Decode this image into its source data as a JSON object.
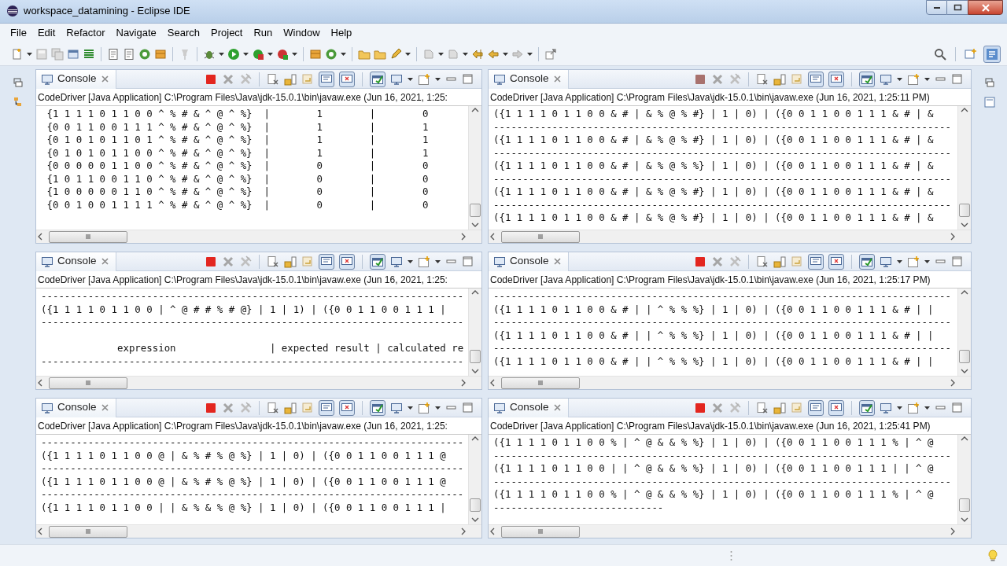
{
  "window": {
    "title": "workspace_datamining - Eclipse IDE"
  },
  "menu": [
    "File",
    "Edit",
    "Refactor",
    "Navigate",
    "Search",
    "Project",
    "Run",
    "Window",
    "Help"
  ],
  "console_toolbar": {
    "stdout_toggle_on": true,
    "stderr_toggle_on": true,
    "pin_on": true
  },
  "consoles": [
    {
      "tab": "Console",
      "running": true,
      "process": "CodeDriver [Java Application] C:\\Program Files\\Java\\jdk-15.0.1\\bin\\javaw.exe  (Jun 16, 2021, 1:25:",
      "lines": [
        {
          "kind": "text",
          "text": " {1 1 1 1 0 1 1 0 0 ^ % # & ^ @ ^ %}  |        1        |        0"
        },
        {
          "kind": "text",
          "text": " {0 0 1 1 0 0 1 1 1 ^ % # & ^ @ ^ %}  |        1        |        1"
        },
        {
          "kind": "text",
          "text": " {0 1 0 1 0 1 1 0 1 ^ % # & ^ @ ^ %}  |        1        |        1"
        },
        {
          "kind": "text",
          "text": " {0 1 0 1 0 1 1 0 0 ^ % # & ^ @ ^ %}  |        1        |        1"
        },
        {
          "kind": "text",
          "text": " {0 0 0 0 0 1 1 0 0 ^ % # & ^ @ ^ %}  |        0        |        0"
        },
        {
          "kind": "text",
          "text": " {1 0 1 1 0 0 1 1 0 ^ % # & ^ @ ^ %}  |        0        |        0"
        },
        {
          "kind": "text",
          "text": " {1 0 0 0 0 0 1 1 0 ^ % # & ^ @ ^ %}  |        0        |        0"
        },
        {
          "kind": "text",
          "text": " {0 0 1 0 0 1 1 1 1 ^ % # & ^ @ ^ %}  |        0        |        0"
        }
      ]
    },
    {
      "tab": "Console",
      "running": false,
      "process": "CodeDriver [Java Application] C:\\Program Files\\Java\\jdk-15.0.1\\bin\\javaw.exe  (Jun 16, 2021, 1:25:11 PM)",
      "lines": [
        {
          "kind": "text",
          "text": "({1 1 1 1 0 1 1 0 0 & # | & % @ % #} | 1 | 0) | ({0 0 1 1 0 0 1 1 1 & # | &"
        },
        {
          "kind": "text",
          "text": "------------------------------------------------------------------------------"
        },
        {
          "kind": "text",
          "text": "({1 1 1 1 0 1 1 0 0 & # | & % @ % #} | 1 | 0) | ({0 0 1 1 0 0 1 1 1 & # | &"
        },
        {
          "kind": "text",
          "text": "------------------------------------------------------------------------------"
        },
        {
          "kind": "text",
          "text": "({1 1 1 1 0 1 1 0 0 & # | & % @ % %} | 1 | 0) | ({0 0 1 1 0 0 1 1 1 & # | &"
        },
        {
          "kind": "text",
          "text": "------------------------------------------------------------------------------"
        },
        {
          "kind": "text",
          "text": "({1 1 1 1 0 1 1 0 0 & # | & % @ % #} | 1 | 0) | ({0 0 1 1 0 0 1 1 1 & # | &"
        },
        {
          "kind": "text",
          "text": "------------------------------------------------------------------------------"
        },
        {
          "kind": "text",
          "text": "({1 1 1 1 0 1 1 0 0 & # | & % @ % #} | 1 | 0) | ({0 0 1 1 0 0 1 1 1 & # | &"
        }
      ]
    },
    {
      "tab": "Console",
      "running": true,
      "process": "CodeDriver [Java Application] C:\\Program Files\\Java\\jdk-15.0.1\\bin\\javaw.exe  (Jun 16, 2021, 1:25:",
      "lines": [
        {
          "kind": "text",
          "text": "------------------------------------------------------------------------"
        },
        {
          "kind": "text",
          "text": "({1 1 1 1 0 1 1 0 0 | ^ @ # # % # @} | 1 | 1) | ({0 0 1 1 0 0 1 1 1 |"
        },
        {
          "kind": "text",
          "text": "------------------------------------------------------------------------"
        },
        {
          "kind": "blank"
        },
        {
          "kind": "text",
          "text": "             expression                | expected result | calculated re"
        },
        {
          "kind": "text",
          "text": "------------------------------------------------------------------------"
        }
      ]
    },
    {
      "tab": "Console",
      "running": true,
      "process": "CodeDriver [Java Application] C:\\Program Files\\Java\\jdk-15.0.1\\bin\\javaw.exe  (Jun 16, 2021, 1:25:17 PM)",
      "lines": [
        {
          "kind": "text",
          "text": "------------------------------------------------------------------------------"
        },
        {
          "kind": "text",
          "text": "({1 1 1 1 0 1 1 0 0 & # | | ^ % % %} | 1 | 0) | ({0 0 1 1 0 0 1 1 1 & # | |"
        },
        {
          "kind": "text",
          "text": "------------------------------------------------------------------------------"
        },
        {
          "kind": "text",
          "text": "({1 1 1 1 0 1 1 0 0 & # | | ^ % % %} | 1 | 0) | ({0 0 1 1 0 0 1 1 1 & # | |"
        },
        {
          "kind": "text",
          "text": "------------------------------------------------------------------------------"
        },
        {
          "kind": "text",
          "text": "({1 1 1 1 0 1 1 0 0 & # | | ^ % % %} | 1 | 0) | ({0 0 1 1 0 0 1 1 1 & # | |"
        }
      ]
    },
    {
      "tab": "Console",
      "running": true,
      "process": "CodeDriver [Java Application] C:\\Program Files\\Java\\jdk-15.0.1\\bin\\javaw.exe  (Jun 16, 2021, 1:25:",
      "lines": [
        {
          "kind": "text",
          "text": "------------------------------------------------------------------------"
        },
        {
          "kind": "text",
          "text": "({1 1 1 1 0 1 1 0 0 @ | & % # % @ %} | 1 | 0) | ({0 0 1 1 0 0 1 1 1 @"
        },
        {
          "kind": "text",
          "text": "------------------------------------------------------------------------"
        },
        {
          "kind": "text",
          "text": "({1 1 1 1 0 1 1 0 0 @ | & % # % @ %} | 1 | 0) | ({0 0 1 1 0 0 1 1 1 @"
        },
        {
          "kind": "text",
          "text": "------------------------------------------------------------------------"
        },
        {
          "kind": "text",
          "text": "({1 1 1 1 0 1 1 0 0 | | & % & % @ %} | 1 | 0) | ({0 0 1 1 0 0 1 1 1 |"
        }
      ]
    },
    {
      "tab": "Console",
      "running": true,
      "process": "CodeDriver [Java Application] C:\\Program Files\\Java\\jdk-15.0.1\\bin\\javaw.exe  (Jun 16, 2021, 1:25:41 PM)",
      "lines": [
        {
          "kind": "text",
          "text": "({1 1 1 1 0 1 1 0 0 % | ^ @ & & % %} | 1 | 0) | ({0 0 1 1 0 0 1 1 1 % | ^ @"
        },
        {
          "kind": "text",
          "text": "------------------------------------------------------------------------------"
        },
        {
          "kind": "text",
          "text": "({1 1 1 1 0 1 1 0 0 | | ^ @ & & % %} | 1 | 0) | ({0 0 1 1 0 0 1 1 1 | | ^ @"
        },
        {
          "kind": "text",
          "text": "------------------------------------------------------------------------------"
        },
        {
          "kind": "text",
          "text": "({1 1 1 1 0 1 1 0 0 % | ^ @ & & % %} | 1 | 0) | ({0 0 1 1 0 0 1 1 1 % | ^ @"
        },
        {
          "kind": "text",
          "text": "-----------------------------"
        }
      ]
    }
  ]
}
